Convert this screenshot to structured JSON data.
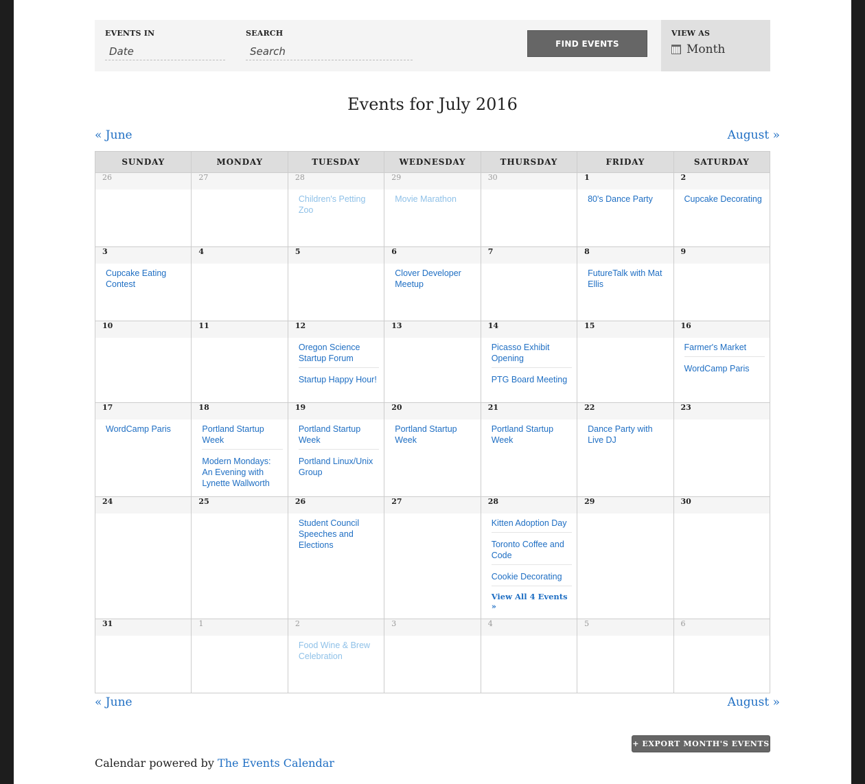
{
  "filter_bar": {
    "events_in_label": "EVENTS IN",
    "date_placeholder": "Date",
    "search_label": "SEARCH",
    "search_placeholder": "Search",
    "find_button": "FIND EVENTS",
    "view_as_label": "VIEW AS",
    "view_as_value": "Month",
    "view_icon": "calendar-icon"
  },
  "title": "Events for July 2016",
  "nav": {
    "prev": "« June",
    "next": "August »"
  },
  "weekdays": [
    "SUNDAY",
    "MONDAY",
    "TUESDAY",
    "WEDNESDAY",
    "THURSDAY",
    "FRIDAY",
    "SATURDAY"
  ],
  "weeks": [
    [
      {
        "day": "26",
        "other": true,
        "events": []
      },
      {
        "day": "27",
        "other": true,
        "events": []
      },
      {
        "day": "28",
        "other": true,
        "events": [
          "Children's Petting Zoo"
        ]
      },
      {
        "day": "29",
        "other": true,
        "events": [
          "Movie Marathon"
        ]
      },
      {
        "day": "30",
        "other": true,
        "events": []
      },
      {
        "day": "1",
        "events": [
          "80's Dance Party"
        ]
      },
      {
        "day": "2",
        "events": [
          "Cupcake Decorating"
        ]
      }
    ],
    [
      {
        "day": "3",
        "events": [
          "Cupcake Eating Contest"
        ]
      },
      {
        "day": "4",
        "events": []
      },
      {
        "day": "5",
        "events": []
      },
      {
        "day": "6",
        "events": [
          "Clover Developer Meetup"
        ]
      },
      {
        "day": "7",
        "events": []
      },
      {
        "day": "8",
        "events": [
          "FutureTalk with Mat Ellis"
        ]
      },
      {
        "day": "9",
        "events": []
      }
    ],
    [
      {
        "day": "10",
        "events": []
      },
      {
        "day": "11",
        "events": []
      },
      {
        "day": "12",
        "events": [
          "Oregon Science Startup Forum",
          "Startup Happy Hour!"
        ]
      },
      {
        "day": "13",
        "events": []
      },
      {
        "day": "14",
        "events": [
          "Picasso Exhibit Opening",
          "PTG Board Meeting"
        ]
      },
      {
        "day": "15",
        "events": []
      },
      {
        "day": "16",
        "events": [
          "Farmer's Market",
          "WordCamp Paris"
        ]
      }
    ],
    [
      {
        "day": "17",
        "events": [
          "WordCamp Paris"
        ]
      },
      {
        "day": "18",
        "events": [
          "Portland Startup Week",
          "Modern Mondays: An Evening with Lynette Wallworth"
        ]
      },
      {
        "day": "19",
        "events": [
          "Portland Startup Week",
          "Portland Linux/Unix Group"
        ]
      },
      {
        "day": "20",
        "events": [
          "Portland Startup Week"
        ]
      },
      {
        "day": "21",
        "events": [
          "Portland Startup Week"
        ]
      },
      {
        "day": "22",
        "events": [
          "Dance Party with Live DJ"
        ]
      },
      {
        "day": "23",
        "events": []
      }
    ],
    [
      {
        "day": "24",
        "events": []
      },
      {
        "day": "25",
        "events": []
      },
      {
        "day": "26",
        "events": [
          "Student Council Speeches and Elections"
        ]
      },
      {
        "day": "27",
        "events": []
      },
      {
        "day": "28",
        "events": [
          "Kitten Adoption Day",
          "Toronto Coffee and Code",
          "Cookie Decorating"
        ],
        "view_all": "View All 4 Events »"
      },
      {
        "day": "29",
        "events": []
      },
      {
        "day": "30",
        "events": []
      }
    ],
    [
      {
        "day": "31",
        "events": []
      },
      {
        "day": "1",
        "other": true,
        "events": []
      },
      {
        "day": "2",
        "other": true,
        "events": [
          "Food Wine & Brew Celebration"
        ]
      },
      {
        "day": "3",
        "other": true,
        "events": []
      },
      {
        "day": "4",
        "other": true,
        "events": []
      },
      {
        "day": "5",
        "other": true,
        "events": []
      },
      {
        "day": "6",
        "other": true,
        "events": []
      }
    ]
  ],
  "row_heights_hint": null,
  "export_button": "+ EXPORT MONTH'S EVENTS",
  "footer": {
    "prefix": "Calendar powered by ",
    "link": "The Events Calendar"
  },
  "colors": {
    "link": "#1e6ec3",
    "link_faded": "#8fc1e8",
    "button": "#666666"
  }
}
